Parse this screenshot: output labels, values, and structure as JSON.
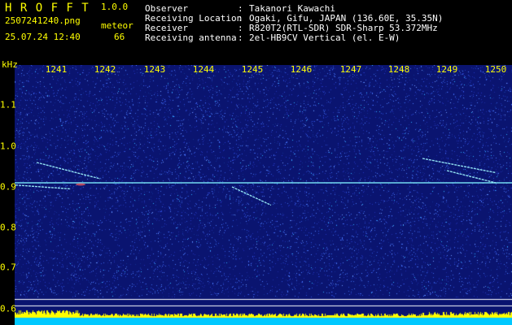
{
  "app": {
    "title": "H R O F F T",
    "version": "1.0.0",
    "filename": "2507241240.png",
    "datetime": "25.07.24 12:40",
    "meteor_label": "meteor",
    "meteor_count": "66"
  },
  "info": [
    {
      "key": "Observer",
      "sep": ":",
      "value": "Takanori Kawachi"
    },
    {
      "key": "Receiving Location",
      "sep": ":",
      "value": "Ogaki, Gifu, JAPAN (136.60E, 35.35N)"
    },
    {
      "key": "Receiver",
      "sep": ":",
      "value": "R820T2(RTL-SDR) SDR-Sharp 53.372MHz"
    },
    {
      "key": "Receiving antenna",
      "sep": ":",
      "value": "2el-HB9CV Vertical (el. E-W)"
    }
  ],
  "spectrogram": {
    "y_unit": "kHz",
    "x_ticks": [
      "1241",
      "1242",
      "1243",
      "1244",
      "1245",
      "1246",
      "1247",
      "1248",
      "1249",
      "1250"
    ],
    "y_ticks": [
      "1.1",
      "1.0",
      "0.9",
      "0.8",
      "0.7",
      "0.6"
    ],
    "colors": {
      "background": "#0a1470",
      "noise": "#2e50d8",
      "carrier": "#7ef0ff",
      "trace": "#9ff6ff",
      "label": "#ffff00",
      "bottom_band": "#00c8ff",
      "bottom_bar": "#ffff00"
    },
    "carrier_khz": 0.91,
    "meteor_traces": [
      {
        "x_start_min": 1240.6,
        "x_end_min": 1241.9,
        "f_start_khz": 0.96,
        "f_end_khz": 0.92
      },
      {
        "x_start_min": 1240.1,
        "x_end_min": 1241.3,
        "f_start_khz": 0.905,
        "f_end_khz": 0.895
      },
      {
        "x_start_min": 1244.6,
        "x_end_min": 1245.4,
        "f_start_khz": 0.9,
        "f_end_khz": 0.855
      },
      {
        "x_start_min": 1248.5,
        "x_end_min": 1250.0,
        "f_start_khz": 0.97,
        "f_end_khz": 0.935
      },
      {
        "x_start_min": 1249.0,
        "x_end_min": 1250.0,
        "f_start_khz": 0.94,
        "f_end_khz": 0.91
      }
    ]
  }
}
